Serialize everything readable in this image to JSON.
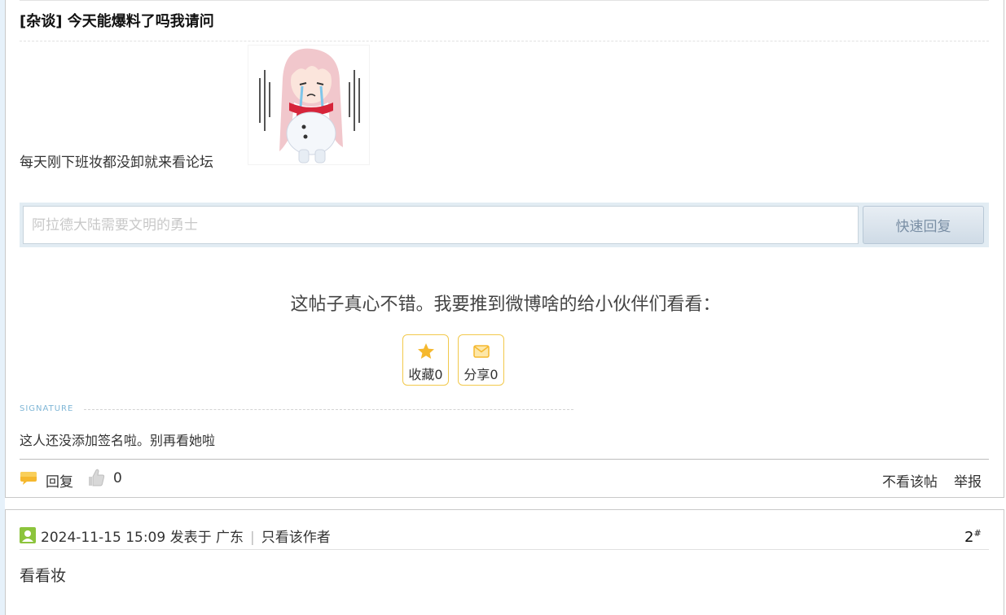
{
  "post": {
    "title": "[杂谈] 今天能爆料了吗我请问",
    "body": "每天刚下班妆都没卸就来看论坛",
    "sticker_alt": "crying-anime-girl-sticker"
  },
  "quick_reply": {
    "placeholder": "阿拉德大陆需要文明的勇士",
    "button_label": "快速回复"
  },
  "share": {
    "prompt": "这帖子真心不错。我要推到微博啥的给小伙伴们看看：",
    "favorite_label": "收藏0",
    "share_label": "分享0"
  },
  "signature": {
    "label": "SIGNATURE",
    "text": "这人还没添加签名啦。别再看她啦"
  },
  "post_footer": {
    "reply_label": "回复",
    "like_count": "0",
    "hide_label": "不看该帖",
    "report_label": "举报"
  },
  "reply": {
    "timestamp": "2024-11-15 15:09",
    "posted_in": "发表于 广东",
    "only_author": "只看该作者",
    "floor": "2",
    "floor_mark": "#",
    "body": "看看妆"
  },
  "colors": {
    "accent_yellow": "#f2c94c",
    "signature_blue": "#7fb6d6",
    "reply_bar_bg": "#e2ecf3",
    "user_icon_green": "#8cc43c"
  }
}
